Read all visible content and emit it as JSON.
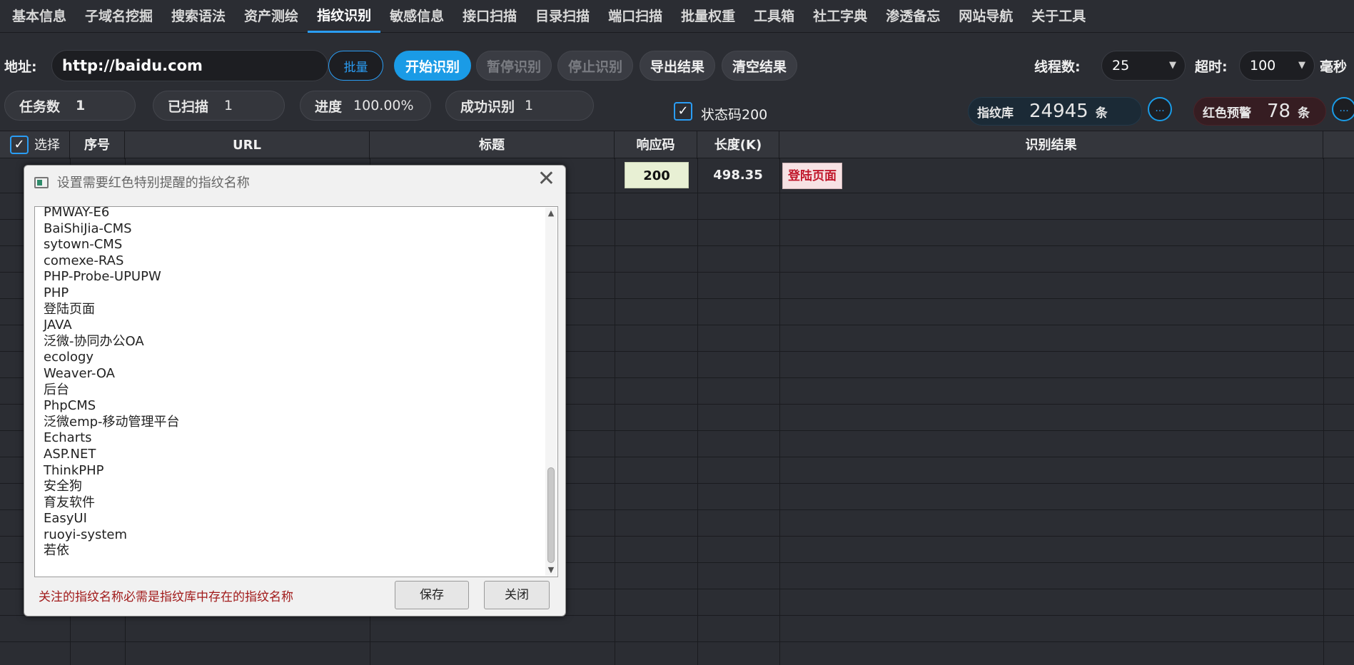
{
  "nav": {
    "items": [
      "基本信息",
      "子域名挖掘",
      "搜索语法",
      "资产测绘",
      "指纹识别",
      "敏感信息",
      "接口扫描",
      "目录扫描",
      "端口扫描",
      "批量权重",
      "工具箱",
      "社工字典",
      "渗透备忘",
      "网站导航",
      "关于工具"
    ],
    "active": "指纹识别"
  },
  "toolbar": {
    "address_label": "地址:",
    "address_value": "http://baidu.com",
    "batch_label": "批量",
    "start_label": "开始识别",
    "pause_label": "暂停识别",
    "stop_label": "停止识别",
    "export_label": "导出结果",
    "clear_label": "清空结果",
    "threads_label": "线程数:",
    "threads_value": "25",
    "timeout_label": "超时:",
    "timeout_value": "100",
    "ms_label": "毫秒"
  },
  "stats": {
    "tasks_label": "任务数",
    "tasks_value": "1",
    "scanned_label": "已扫描",
    "scanned_value": "1",
    "progress_label": "进度",
    "progress_value": "100.00%",
    "success_label": "成功识别",
    "success_value": "1",
    "status200_label": "状态码200",
    "status200_checked": true,
    "library_label": "指纹库",
    "library_value": "24945",
    "library_unit": "条",
    "alert_label": "红色预警",
    "alert_value": "78",
    "alert_unit": "条",
    "more_label": "..."
  },
  "table": {
    "headers": [
      "选择",
      "序号",
      "URL",
      "标题",
      "响应码",
      "长度(K)",
      "识别结果"
    ],
    "rows": [
      {
        "code": "200",
        "length": "498.35",
        "result": "登陆页面"
      }
    ]
  },
  "dialog": {
    "title": "设置需要红色特别提醒的指纹名称",
    "close_glyph": "✕",
    "items": [
      "PMWAY-E6",
      "BaiShiJia-CMS",
      "sytown-CMS",
      "comexe-RAS",
      "PHP-Probe-UPUPW",
      "PHP",
      "登陆页面",
      "JAVA",
      "泛微-协同办公OA",
      "ecology",
      "Weaver-OA",
      "后台",
      "PhpCMS",
      "泛微emp-移动管理平台",
      "Echarts",
      "ASP.NET",
      "ThinkPHP",
      "安全狗",
      "育友软件",
      "EasyUI",
      "ruoyi-system",
      "若依"
    ],
    "note": "关注的指纹名称必需是指纹库中存在的指纹名称",
    "save_label": "保存",
    "close_label": "关闭"
  },
  "colors": {
    "accent": "#1a9be6",
    "alert": "#c0162a",
    "background": "#2b2d33"
  }
}
